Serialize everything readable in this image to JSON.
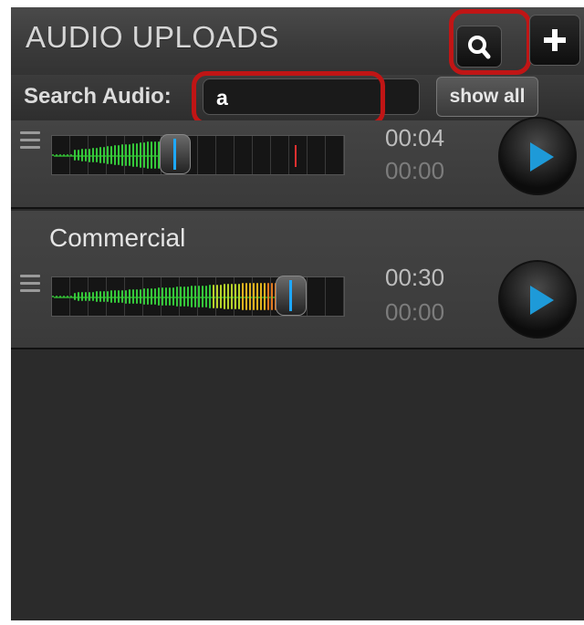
{
  "header": {
    "title": "AUDIO UPLOADS",
    "search_icon": "search-icon",
    "add_icon": "plus-icon"
  },
  "search": {
    "label": "Search Audio:",
    "value": "a",
    "show_all": "show all"
  },
  "tracks": [
    {
      "name": "",
      "time_total": "00:04",
      "time_current": "00:00",
      "level": 0.42
    },
    {
      "name": "Commercial",
      "time_total": "00:30",
      "time_current": "00:00",
      "level": 0.82
    }
  ],
  "colors": {
    "accent": "#1ea8ff",
    "highlight": "#c01515",
    "play": "#1e9ad8"
  }
}
